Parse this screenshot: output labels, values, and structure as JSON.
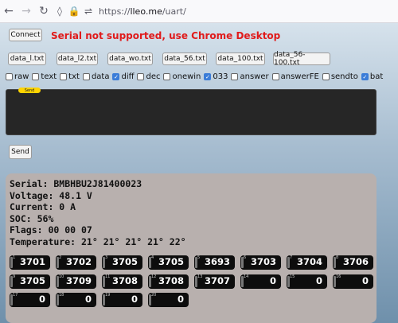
{
  "browser": {
    "url_prefix": "https://",
    "url_host": "lleo.me",
    "url_path": "/uart/"
  },
  "connect_label": "Connect",
  "warning": "Serial not supported, use Chrome Desktop",
  "files": [
    "data_l.txt",
    "data_l2.txt",
    "data_wo.txt",
    "data_56.txt",
    "data_100.txt",
    "data_56-100.txt"
  ],
  "checkboxes": [
    {
      "label": "raw",
      "checked": false
    },
    {
      "label": "text",
      "checked": false
    },
    {
      "label": "txt",
      "checked": false
    },
    {
      "label": "data",
      "checked": false
    },
    {
      "label": "diff",
      "checked": true
    },
    {
      "label": "dec",
      "checked": false
    },
    {
      "label": "onewin",
      "checked": false
    },
    {
      "label": "033",
      "checked": true
    },
    {
      "label": "answer",
      "checked": false
    },
    {
      "label": "answerFE",
      "checked": false
    },
    {
      "label": "sendto",
      "checked": false
    },
    {
      "label": "bat",
      "checked": true
    }
  ],
  "terminal_send_label": "Send",
  "send_label": "Send",
  "info": {
    "serial": "Serial: BMBHBU2J81400023",
    "voltage": "Voltage: 48.1 V",
    "current": "Current: 0 A",
    "soc": "SOC: 56%",
    "flags": "Flags: 00 00 07",
    "temperature": "Temperature: 21° 21° 21° 21° 22°"
  },
  "cells": [
    {
      "index": "1",
      "value": "3701"
    },
    {
      "index": "2",
      "value": "3702"
    },
    {
      "index": "3",
      "value": "3705"
    },
    {
      "index": "4",
      "value": "3705"
    },
    {
      "index": "5",
      "value": "3693"
    },
    {
      "index": "6",
      "value": "3703"
    },
    {
      "index": "7",
      "value": "3704"
    },
    {
      "index": "8",
      "value": "3706"
    },
    {
      "index": "9",
      "value": "3705"
    },
    {
      "index": "10",
      "value": "3709"
    },
    {
      "index": "11",
      "value": "3708"
    },
    {
      "index": "12",
      "value": "3708"
    },
    {
      "index": "13",
      "value": "3707"
    },
    {
      "index": "14",
      "value": "0"
    },
    {
      "index": "15",
      "value": "0"
    },
    {
      "index": "16",
      "value": "0"
    },
    {
      "index": "17",
      "value": "0"
    },
    {
      "index": "18",
      "value": "0"
    },
    {
      "index": "19",
      "value": "0"
    },
    {
      "index": "20",
      "value": "0"
    }
  ]
}
